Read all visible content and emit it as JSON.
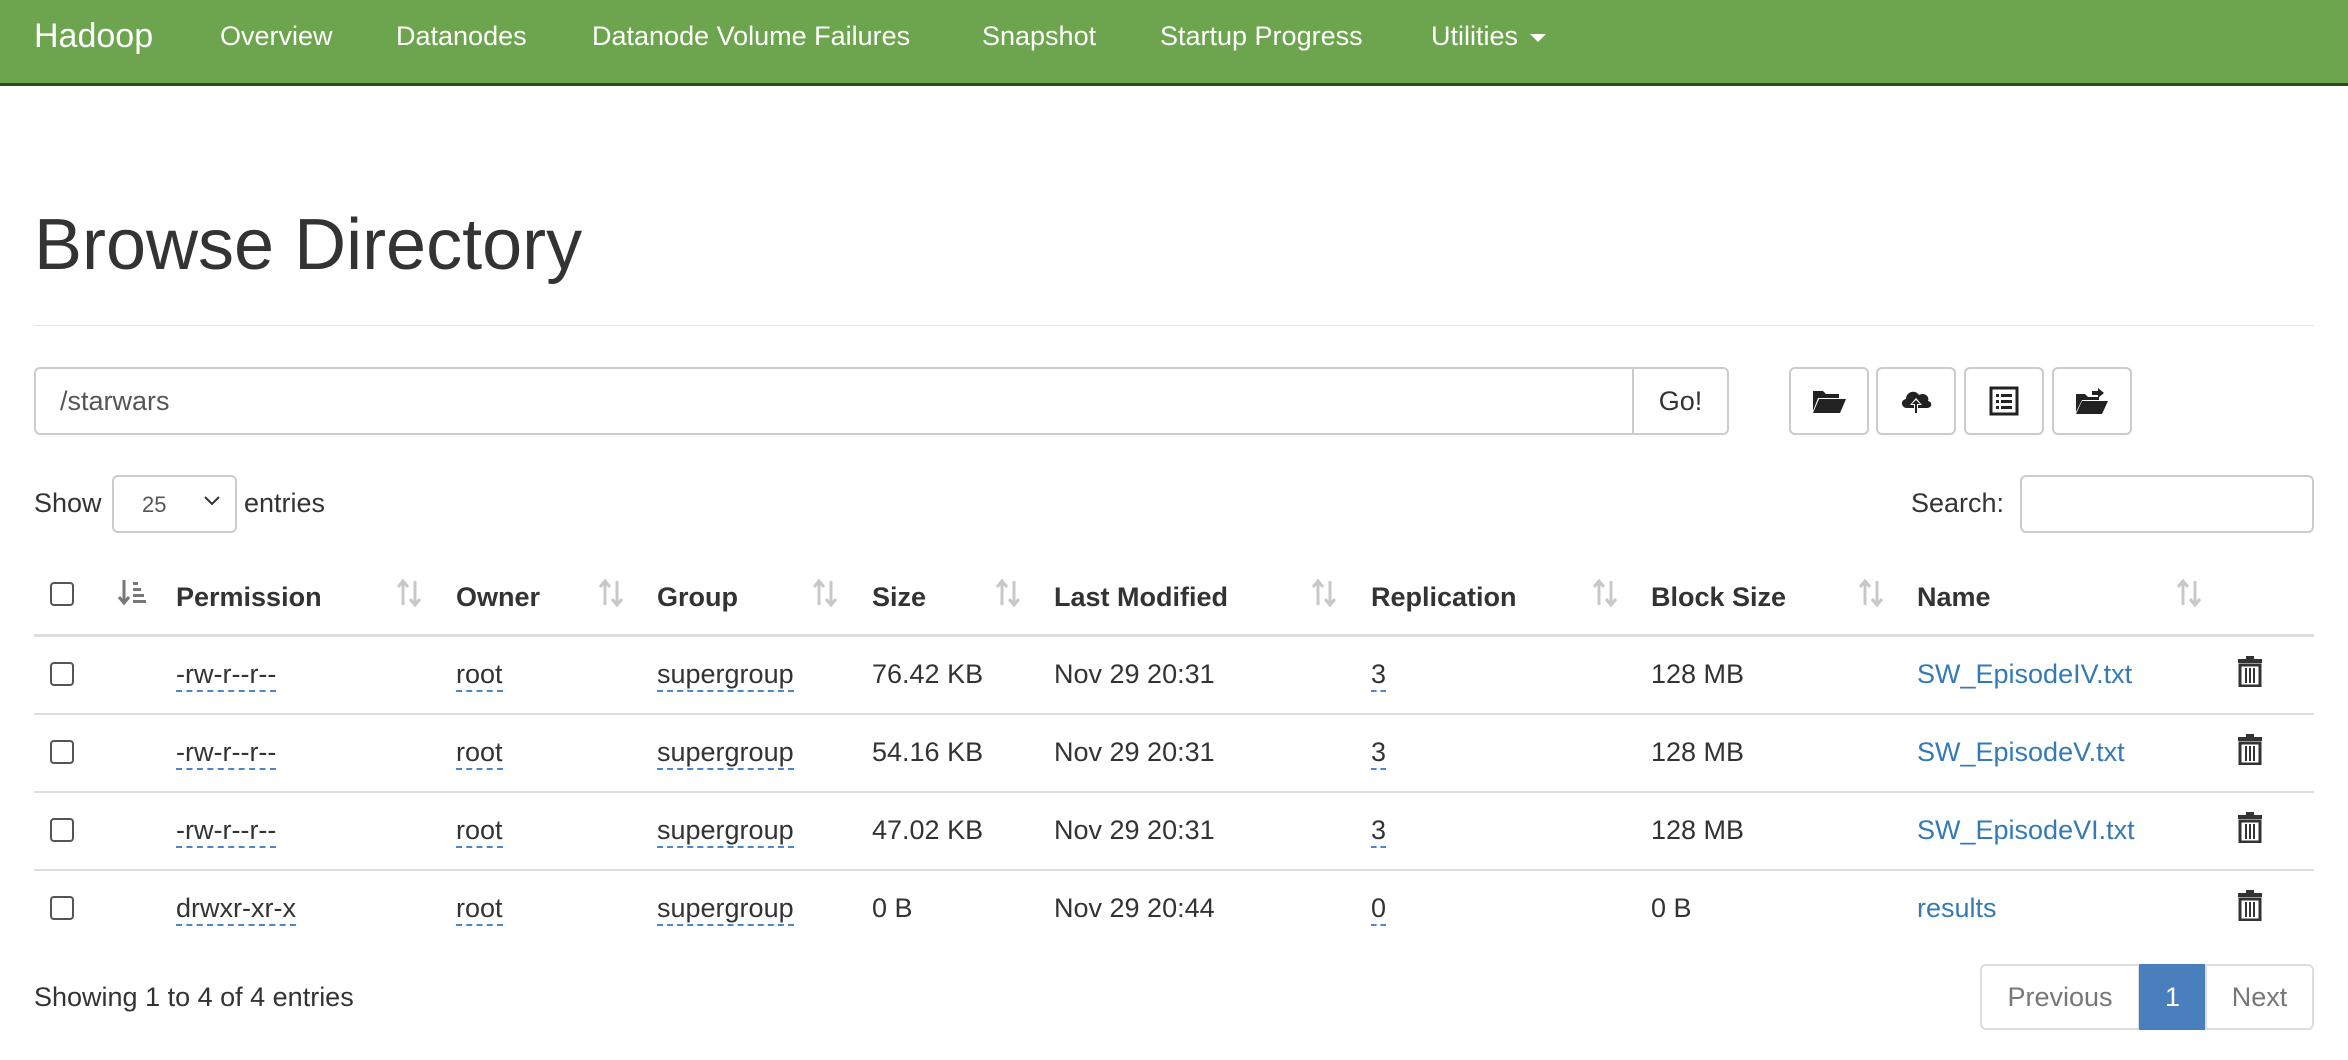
{
  "navbar": {
    "brand": "Hadoop",
    "items": [
      "Overview",
      "Datanodes",
      "Datanode Volume Failures",
      "Snapshot",
      "Startup Progress",
      "Utilities"
    ]
  },
  "page": {
    "title": "Browse Directory"
  },
  "path_form": {
    "path_value": "/starwars",
    "go_label": "Go!",
    "tools": [
      "folder-open-icon",
      "upload-cloud-icon",
      "list-icon",
      "move-folder-icon"
    ]
  },
  "length": {
    "show_label": "Show",
    "selected": "25",
    "entries_label": "entries"
  },
  "search": {
    "label": "Search:",
    "value": ""
  },
  "table": {
    "headers": [
      "Permission",
      "Owner",
      "Group",
      "Size",
      "Last Modified",
      "Replication",
      "Block Size",
      "Name"
    ],
    "rows": [
      {
        "permission": "-rw-r--r--",
        "owner": "root",
        "group": "supergroup",
        "size": "76.42 KB",
        "modified": "Nov 29 20:31",
        "replication": "3",
        "block_size": "128 MB",
        "name": "SW_EpisodeIV.txt"
      },
      {
        "permission": "-rw-r--r--",
        "owner": "root",
        "group": "supergroup",
        "size": "54.16 KB",
        "modified": "Nov 29 20:31",
        "replication": "3",
        "block_size": "128 MB",
        "name": "SW_EpisodeV.txt"
      },
      {
        "permission": "-rw-r--r--",
        "owner": "root",
        "group": "supergroup",
        "size": "47.02 KB",
        "modified": "Nov 29 20:31",
        "replication": "3",
        "block_size": "128 MB",
        "name": "SW_EpisodeVI.txt"
      },
      {
        "permission": "drwxr-xr-x",
        "owner": "root",
        "group": "supergroup",
        "size": "0 B",
        "modified": "Nov 29 20:44",
        "replication": "0",
        "block_size": "0 B",
        "name": "results"
      }
    ]
  },
  "footer": {
    "info": "Showing 1 to 4 of 4 entries",
    "previous": "Previous",
    "current_page": "1",
    "next": "Next"
  },
  "colors": {
    "navbar": "#6ca54d",
    "link": "#337ab7",
    "active_page": "#4a7fbd"
  }
}
